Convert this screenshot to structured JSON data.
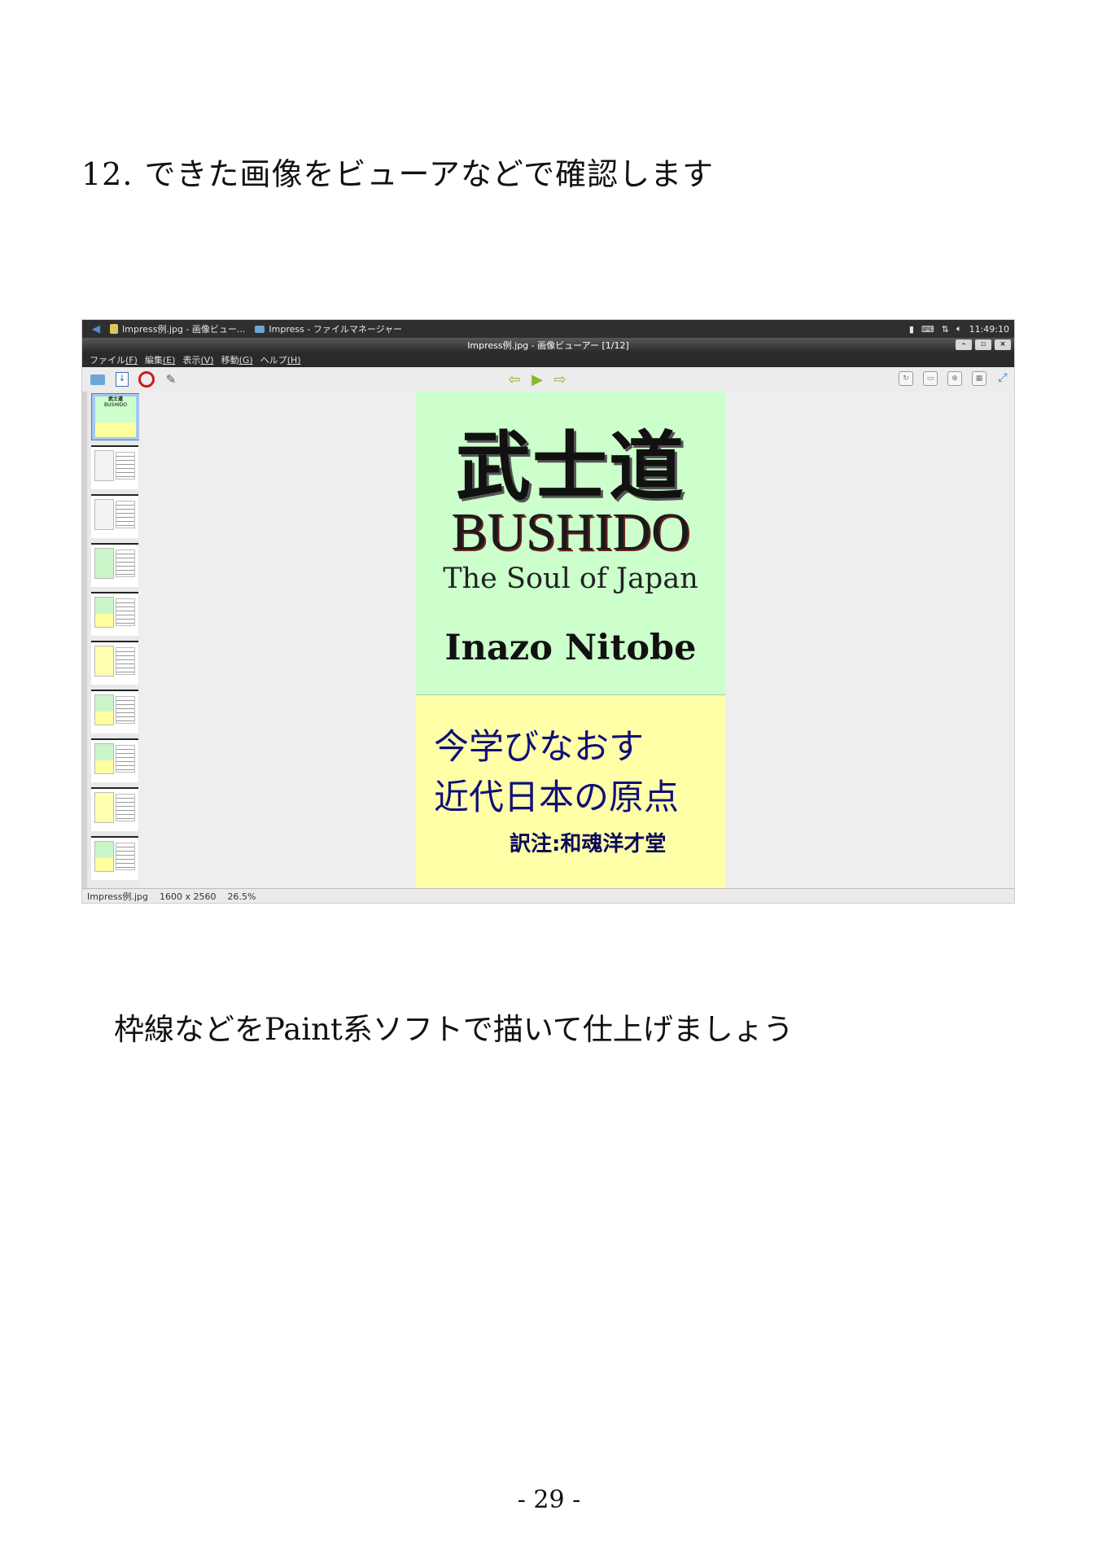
{
  "heading": {
    "number": "12.",
    "text": "できた画像をビューアなどで確認します"
  },
  "screenshot": {
    "taskbar": {
      "task1": "Impress例.jpg - 画像ビュー...",
      "task2": "Impress - ファイルマネージャー",
      "clock": "11:49:10"
    },
    "title": "Impress例.jpg - 画像ビューアー [1/12]",
    "window_buttons": [
      "–",
      "▫",
      "×"
    ],
    "menu": [
      {
        "label": "ファイル",
        "key": "(F)"
      },
      {
        "label": "編集",
        "key": "(E)"
      },
      {
        "label": "表示",
        "key": "(V)"
      },
      {
        "label": "移動",
        "key": "(G)"
      },
      {
        "label": "ヘルプ",
        "key": "(H)"
      }
    ],
    "cover": {
      "kanji": "武士道",
      "romaji": "BUSHIDO",
      "subtitle": "The Soul of Japan",
      "author": "Inazo Nitobe",
      "line1": "今学びなおす",
      "line2": "近代日本の原点",
      "translator": "訳注:和魂洋才堂",
      "colors": {
        "top": "#ccffcc",
        "bottom": "#ffffa8",
        "jp_text": "#10107a"
      }
    },
    "status": {
      "filename": "Impress例.jpg",
      "dimensions": "1600 x 2560",
      "zoom": "26.5%"
    }
  },
  "subtext": "枠線などをPaint系ソフトで描いて仕上げましょう",
  "page_number": "- 29 -"
}
